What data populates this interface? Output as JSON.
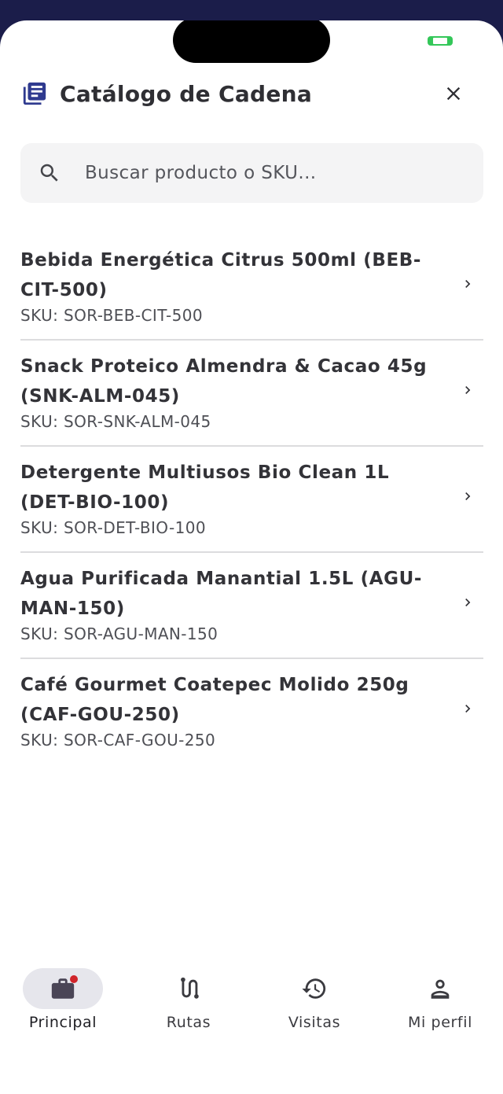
{
  "header": {
    "title": "Catálogo de Cadena"
  },
  "search": {
    "placeholder": "Buscar producto o SKU..."
  },
  "products": [
    {
      "name": "Bebida Energética Citrus 500ml (BEB-CIT-500)",
      "sku": "SKU: SOR-BEB-CIT-500"
    },
    {
      "name": "Snack Proteico Almendra & Cacao 45g (SNK-ALM-045)",
      "sku": "SKU: SOR-SNK-ALM-045"
    },
    {
      "name": "Detergente Multiusos Bio Clean 1L (DET-BIO-100)",
      "sku": "SKU: SOR-DET-BIO-100"
    },
    {
      "name": "Agua Purificada Manantial 1.5L (AGU-MAN-150)",
      "sku": "SKU: SOR-AGU-MAN-150"
    },
    {
      "name": "Café Gourmet Coatepec Molido 250g (CAF-GOU-250)",
      "sku": "SKU: SOR-CAF-GOU-250"
    }
  ],
  "nav": {
    "tabs": [
      {
        "label": "Principal",
        "icon": "briefcase-icon",
        "active": true
      },
      {
        "label": "Rutas",
        "icon": "route-icon",
        "active": false
      },
      {
        "label": "Visitas",
        "icon": "history-icon",
        "active": false
      },
      {
        "label": "Mi perfil",
        "icon": "person-icon",
        "active": false
      }
    ]
  },
  "colors": {
    "accent": "#2f3a8f",
    "status_bar": "#1b1d4a",
    "badge": "#d0242a",
    "battery": "#34c759"
  }
}
